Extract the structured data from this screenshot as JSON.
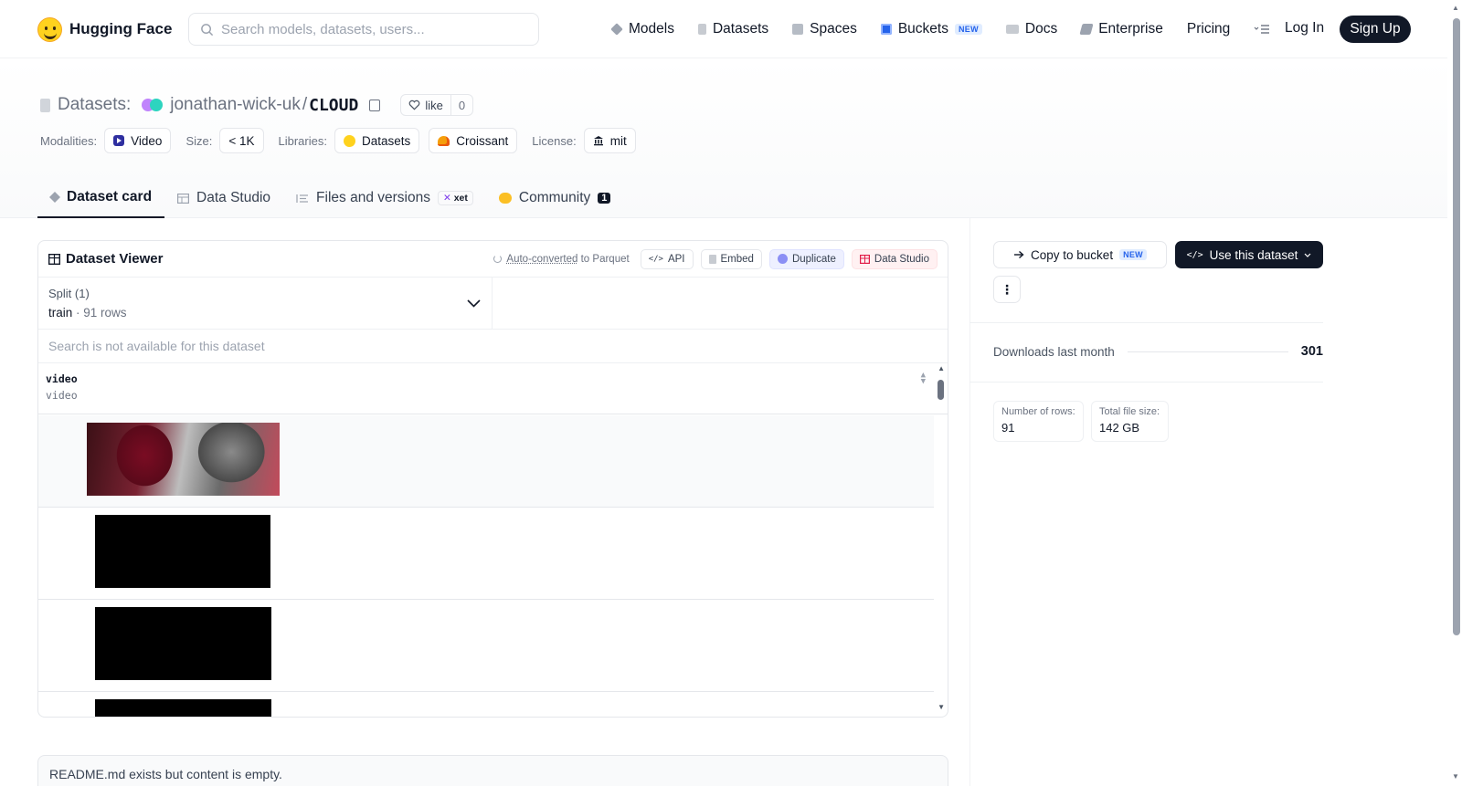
{
  "nav": {
    "brand": "Hugging Face",
    "search_placeholder": "Search models, datasets, users...",
    "links": [
      {
        "label": "Models",
        "icon": "models-icon"
      },
      {
        "label": "Datasets",
        "icon": "datasets-icon"
      },
      {
        "label": "Spaces",
        "icon": "spaces-icon"
      },
      {
        "label": "Buckets",
        "icon": "buckets-icon",
        "badge": "NEW"
      },
      {
        "label": "Docs",
        "icon": "docs-icon"
      },
      {
        "label": "Enterprise",
        "icon": "enterprise-icon"
      },
      {
        "label": "Pricing"
      }
    ],
    "login": "Log In",
    "signup": "Sign Up"
  },
  "header": {
    "kind": "Datasets:",
    "owner": "jonathan-wick-uk",
    "separator": "/",
    "name": "CLOUD",
    "like_label": "like",
    "like_count": "0",
    "meta": {
      "modalities_label": "Modalities:",
      "modalities_value": "Video",
      "size_label": "Size:",
      "size_value": "< 1K",
      "libraries_label": "Libraries:",
      "library_1": "Datasets",
      "library_2": "Croissant",
      "license_label": "License:",
      "license_value": "mit"
    }
  },
  "tabs": {
    "card": "Dataset card",
    "studio": "Data Studio",
    "files": "Files and versions",
    "xet": "xet",
    "community": "Community",
    "community_count": "1"
  },
  "viewer": {
    "title": "Dataset Viewer",
    "auto_link": "Auto-converted",
    "auto_rest": " to Parquet",
    "api": "API",
    "embed": "Embed",
    "duplicate": "Duplicate",
    "data_studio": "Data Studio",
    "split_title": "Split (1)",
    "split_name": "train",
    "split_dot": " · ",
    "split_rows": "91 rows",
    "search_unavailable": "Search is not available for this dataset",
    "column_name": "video",
    "column_type": "video"
  },
  "readme": "README.md exists but content is empty.",
  "sidebar": {
    "copy_bucket": "Copy to bucket",
    "copy_bucket_badge": "NEW",
    "use_dataset": "Use this dataset",
    "more": "⋮",
    "downloads_label": "Downloads last month",
    "downloads_value": "301",
    "rows_label": "Number of rows:",
    "rows_value": "91",
    "size_label": "Total file size:",
    "size_value": "142 GB"
  },
  "colors": {
    "brand_yellow": "#ffd21e",
    "dark": "#111827",
    "new_badge": "#2563eb"
  }
}
